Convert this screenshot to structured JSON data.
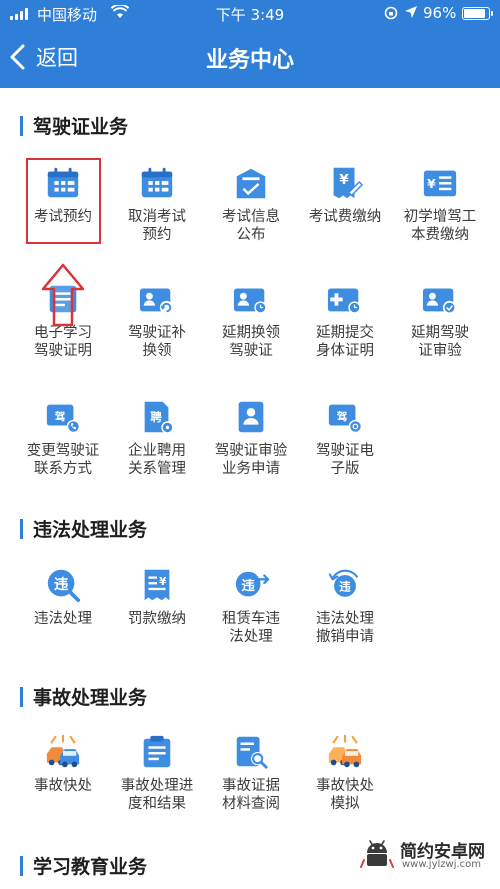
{
  "status_bar": {
    "carrier": "中国移动",
    "time": "下午 3:49",
    "battery_pct": "96%",
    "battery_level": 0.96
  },
  "nav": {
    "back_label": "返回",
    "title": "业务中心"
  },
  "sections": [
    {
      "title": "驾驶证业务",
      "items": [
        {
          "label": "考试预约",
          "icon": "calendar-icon"
        },
        {
          "label": "取消考试\n预约",
          "icon": "calendar-icon"
        },
        {
          "label": "考试信息\n公布",
          "icon": "exam-info-icon"
        },
        {
          "label": "考试费缴纳",
          "icon": "fee-receipt-icon"
        },
        {
          "label": "初学增驾工\n本费缴纳",
          "icon": "yuan-list-icon"
        },
        {
          "label": "电子学习\n驾驶证明",
          "icon": "e-certificate-icon"
        },
        {
          "label": "驾驶证补\n换领",
          "icon": "license-reissue-icon"
        },
        {
          "label": "延期换领\n驾驶证",
          "icon": "license-extend-icon"
        },
        {
          "label": "延期提交\n身体证明",
          "icon": "health-extend-icon"
        },
        {
          "label": "延期驾驶\n证审验",
          "icon": "license-verify-icon"
        },
        {
          "label": "变更驾驶证\n联系方式",
          "icon": "phone-contact-icon"
        },
        {
          "label": "企业聘用\n关系管理",
          "icon": "employ-icon"
        },
        {
          "label": "驾驶证审验\n业务申请",
          "icon": "id-card-icon"
        },
        {
          "label": "驾驶证电\n子版",
          "icon": "e-license-icon"
        }
      ]
    },
    {
      "title": "违法处理业务",
      "items": [
        {
          "label": "违法处理",
          "icon": "violation-icon"
        },
        {
          "label": "罚款缴纳",
          "icon": "fine-payment-icon"
        },
        {
          "label": "租赁车违\n法处理",
          "icon": "rental-violation-icon"
        },
        {
          "label": "违法处理\n撤销申请",
          "icon": "violation-revoke-icon"
        }
      ]
    },
    {
      "title": "事故处理业务",
      "items": [
        {
          "label": "事故快处",
          "icon": "car-accident-icon"
        },
        {
          "label": "事故处理进\n度和结果",
          "icon": "progress-list-icon"
        },
        {
          "label": "事故证据\n材料查阅",
          "icon": "document-search-icon"
        },
        {
          "label": "事故快处\n模拟",
          "icon": "car-accident-orange-icon"
        }
      ]
    },
    {
      "title": "学习教育业务",
      "items": []
    }
  ],
  "watermark": {
    "name": "简约安卓网",
    "url": "www.jylzwj.com"
  },
  "colors": {
    "primary": "#2f7fd8",
    "icon_blue": "#3f8de0",
    "accent_orange": "#f08a3c",
    "highlight_red": "#d9343a"
  }
}
